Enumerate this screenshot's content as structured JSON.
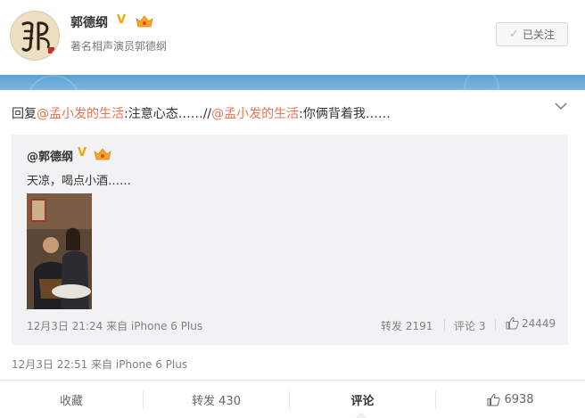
{
  "profile": {
    "name": "郭德纲",
    "verified_mark": "V",
    "bio": "著名相声演员郭德纲",
    "follow_label": "已关注",
    "follow_icon": "check-icon"
  },
  "post": {
    "parts": [
      {
        "text": "回复",
        "mention": false
      },
      {
        "text": "@孟小发的生活",
        "mention": true
      },
      {
        "text": ":注意心态……//",
        "mention": false
      },
      {
        "text": "@孟小发的生活",
        "mention": true
      },
      {
        "text": ":你俩背着我……",
        "mention": false
      }
    ],
    "menu_icon": "chevron-down-icon",
    "time": "12月3日 22:51 来自 iPhone 6 Plus"
  },
  "repost": {
    "author": "@郭德纲",
    "verified_mark": "V",
    "text": "天凉，喝点小酒……",
    "time": "12月3日 21:24 来自 iPhone 6 Plus",
    "forward": "转发 2191",
    "comment": "评论 3",
    "likes": "24449"
  },
  "actions": {
    "favorite": "收藏",
    "forward": "转发 430",
    "comment": "评论",
    "likes": "6938"
  },
  "colors": {
    "mention": "#eb7350",
    "verified": "#f0a800",
    "cover": "#5aa0d2"
  }
}
